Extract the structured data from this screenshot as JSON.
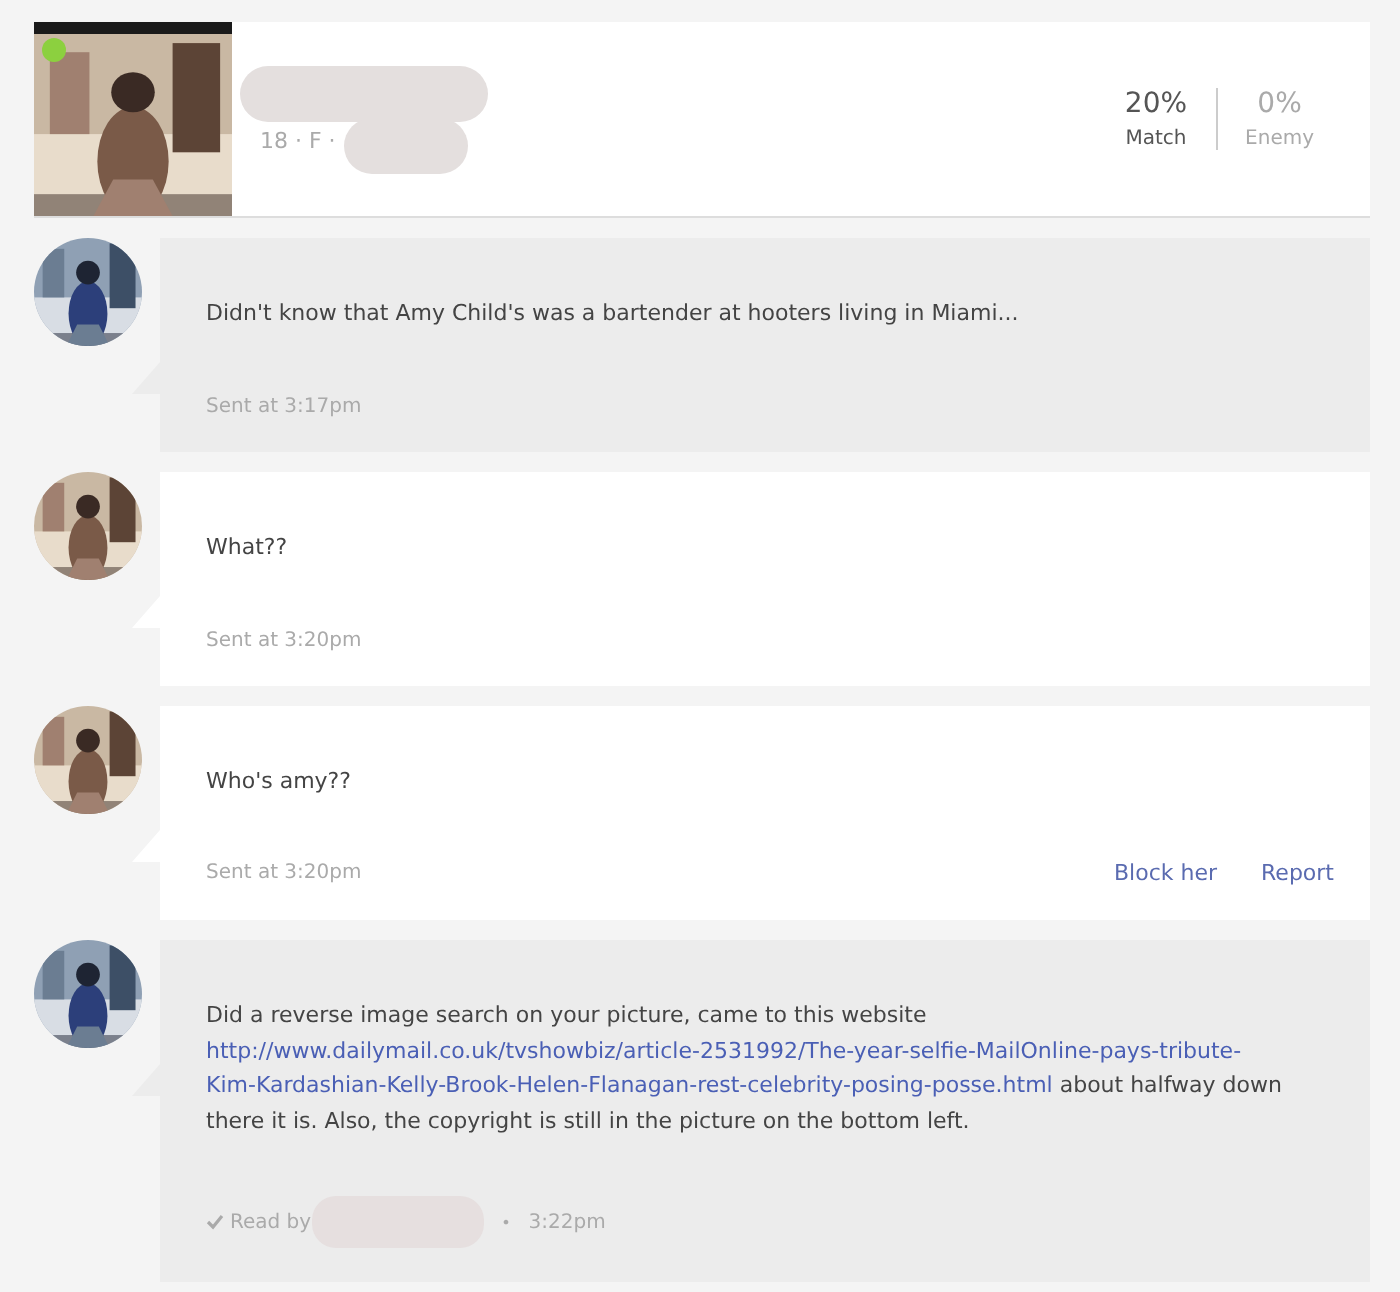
{
  "profile": {
    "photo": {
      "kind": "picture"
    },
    "online": true,
    "name_redacted": true,
    "details": "18 · F ·",
    "details_redacted": true,
    "stats": [
      {
        "kind": "match",
        "value": "20%",
        "label": "Match"
      },
      {
        "kind": "enemy",
        "value": "0%",
        "label": "Enemy"
      }
    ]
  },
  "messages": [
    {
      "kind": "outgoing",
      "avatar": {
        "kind": "picture"
      },
      "body": [
        {
          "kind": "text",
          "text": "Didn't know that Amy Child's was a bartender at hooters living in Miami..."
        }
      ],
      "footer": [
        {
          "kind": "text",
          "text": "Sent at 3:17pm"
        }
      ]
    },
    {
      "kind": "incoming",
      "avatar": {
        "kind": "picture"
      },
      "body": [
        {
          "kind": "text",
          "text": "What??"
        }
      ],
      "footer": [
        {
          "kind": "text",
          "text": "Sent at 3:20pm"
        }
      ]
    },
    {
      "kind": "incoming",
      "avatar": {
        "kind": "picture"
      },
      "body": [
        {
          "kind": "text",
          "text": "Who's amy??"
        }
      ],
      "footer": [
        {
          "kind": "text",
          "text": "Sent at 3:20pm"
        }
      ],
      "actions": [
        "Block her",
        "Report"
      ]
    },
    {
      "kind": "outgoing",
      "avatar": {
        "kind": "picture"
      },
      "body": [
        {
          "kind": "text",
          "text": "Did a reverse image search on your picture, came to this website "
        },
        {
          "kind": "link",
          "lines": [
            "http://www.dailymail.co.uk/tvshowbiz/article-2531992/The-year-selfie-MailOnline-pays-tribute-",
            "Kim-Kardashian-Kelly-Brook-Helen-Flanagan-rest-celebrity-posing-posse.html"
          ]
        },
        {
          "kind": "text",
          "text": " about halfway down there it is. Also, the copyright is still in the picture on the bottom left."
        }
      ],
      "footer": [
        {
          "kind": "read",
          "text": "Read by"
        },
        {
          "kind": "redacted"
        },
        {
          "kind": "dot",
          "text": "•"
        },
        {
          "kind": "text",
          "text": "3:22pm"
        }
      ]
    }
  ]
}
